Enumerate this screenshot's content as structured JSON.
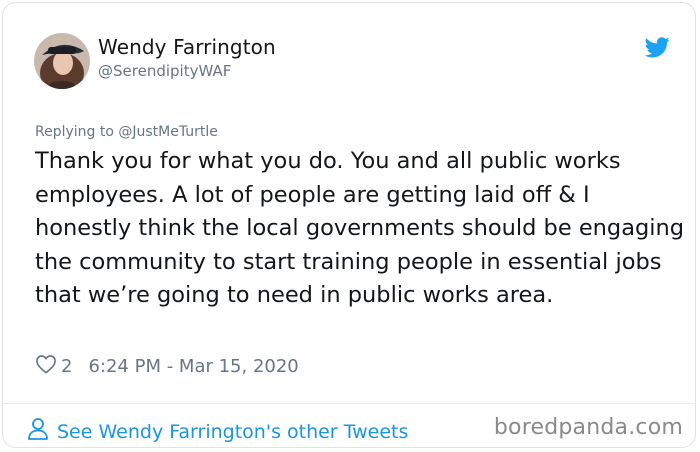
{
  "author": {
    "name": "Wendy Farrington",
    "handle": "@SerendipityWAF",
    "avatar_icon": "profile-photo"
  },
  "platform_icon": "twitter-bird-icon",
  "accent_color": "#1da1f2",
  "reply_to": "Replying to @JustMeTurtle",
  "tweet_text": "Thank you for what you do.  You and all public works employees.  A lot of people are getting laid off & I honestly think the local governments should be engaging the community to start training people in essential jobs that we’re going to need in public works area.",
  "likes": "2",
  "timestamp": "6:24 PM - Mar 15, 2020",
  "footer": {
    "link_text": "See Wendy Farrington's other Tweets",
    "link_color": "#1b95e0"
  },
  "watermark": "boredpanda.com"
}
